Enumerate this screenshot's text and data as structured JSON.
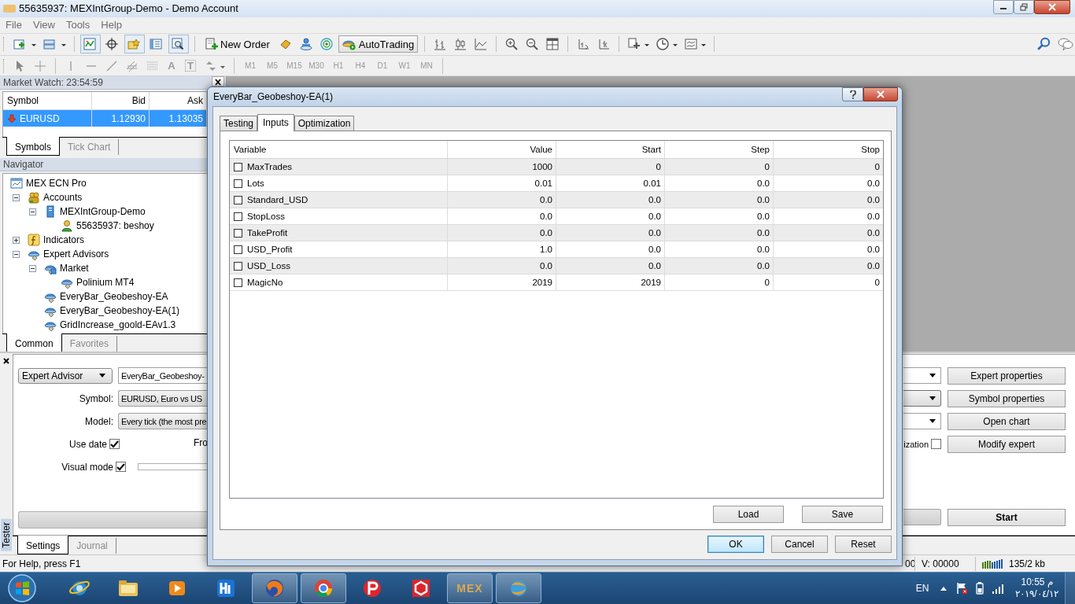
{
  "window": {
    "title": "55635937: MEXIntGroup-Demo - Demo Account"
  },
  "menu": [
    "File",
    "View",
    "Tools",
    "Help"
  ],
  "toolbar": {
    "new_order": "New Order",
    "autotrading": {
      "label": "AutoTrading",
      "on": true
    }
  },
  "toolbar2": {
    "text_tool": "A",
    "label_tool": "T",
    "timeframes": [
      {
        "label": "M1",
        "disabled": true
      },
      {
        "label": "M5",
        "disabled": true
      },
      {
        "label": "M15",
        "disabled": true
      },
      {
        "label": "M30",
        "disabled": true
      },
      {
        "label": "H1",
        "disabled": true
      },
      {
        "label": "H4",
        "disabled": true
      },
      {
        "label": "D1",
        "disabled": true
      },
      {
        "label": "W1",
        "disabled": true
      },
      {
        "label": "MN",
        "disabled": true
      }
    ]
  },
  "market_watch": {
    "title": "Market Watch: 23:54:59",
    "columns": [
      "Symbol",
      "Bid",
      "Ask"
    ],
    "rows": [
      {
        "symbol": "EURUSD",
        "bid": "1.12930",
        "ask": "1.13035",
        "selected": true
      }
    ],
    "tabs": [
      {
        "label": "Symbols",
        "selected": true
      },
      {
        "label": "Tick Chart",
        "selected": false
      }
    ]
  },
  "navigator": {
    "title": "Navigator",
    "tree": [
      {
        "label": "MEX ECN Pro",
        "kind": "terminal",
        "children": [
          {
            "label": "Accounts",
            "kind": "accounts",
            "expanded": true,
            "children": [
              {
                "label": "MEXIntGroup-Demo",
                "kind": "server",
                "expanded": true,
                "children": [
                  {
                    "label": "55635937: beshoy",
                    "kind": "user"
                  }
                ]
              }
            ]
          },
          {
            "label": "Indicators",
            "kind": "indicator",
            "expanded": false
          },
          {
            "label": "Expert Advisors",
            "kind": "expert",
            "expanded": true,
            "children": [
              {
                "label": "Market",
                "kind": "market",
                "expanded": true,
                "children": [
                  {
                    "label": "Polinium MT4",
                    "kind": "expert"
                  }
                ]
              },
              {
                "label": "EveryBar_Geobeshoy-EA",
                "kind": "expert"
              },
              {
                "label": "EveryBar_Geobeshoy-EA(1)",
                "kind": "expert"
              },
              {
                "label": "GridIncrease_goold-EAv1.3",
                "kind": "expert"
              }
            ]
          }
        ]
      }
    ],
    "tabs": [
      {
        "label": "Common",
        "selected": true
      },
      {
        "label": "Favorites",
        "selected": false
      }
    ]
  },
  "tester": {
    "tab_label": "Tester",
    "type_select": "Expert Advisor",
    "expert_field": "EveryBar_Geobeshoy-",
    "symbol_label": "Symbol:",
    "symbol_value": "EURUSD, Euro vs US",
    "model_label": "Model:",
    "model_value": "Every tick (the most pre",
    "use_date": {
      "label": "Use date",
      "checked": true
    },
    "from_label": "Fro",
    "visual_mode": {
      "label": "Visual mode",
      "checked": true
    },
    "speed": {
      "level": 0
    },
    "progress": {
      "level": 0
    },
    "optimization": {
      "label": "ization",
      "checked": false
    },
    "buttons": [
      "Expert properties",
      "Symbol properties",
      "Open chart",
      "Modify expert"
    ],
    "start": "Start",
    "tabs": [
      {
        "label": "Settings",
        "selected": true
      },
      {
        "label": "Journal",
        "selected": false
      }
    ]
  },
  "status_bar": {
    "help": "For Help, press F1",
    "cell_1": "00",
    "cell_2": "V: 00000",
    "traffic": "135/2 kb"
  },
  "dialog": {
    "title": "EveryBar_Geobeshoy-EA(1)",
    "tabs": [
      {
        "label": "Testing",
        "selected": false
      },
      {
        "label": "Inputs",
        "selected": true
      },
      {
        "label": "Optimization",
        "selected": false
      }
    ],
    "columns": [
      "Variable",
      "Value",
      "Start",
      "Step",
      "Stop"
    ],
    "rows": [
      {
        "variable": "MaxTrades",
        "value": "1000",
        "start": "0",
        "step": "0",
        "stop": "0",
        "checked": false
      },
      {
        "variable": "Lots",
        "value": "0.01",
        "start": "0.01",
        "step": "0.0",
        "stop": "0.0",
        "checked": false
      },
      {
        "variable": "Standard_USD",
        "value": "0.0",
        "start": "0.0",
        "step": "0.0",
        "stop": "0.0",
        "checked": false
      },
      {
        "variable": "StopLoss",
        "value": "0.0",
        "start": "0.0",
        "step": "0.0",
        "stop": "0.0",
        "checked": false
      },
      {
        "variable": "TakeProfit",
        "value": "0.0",
        "start": "0.0",
        "step": "0.0",
        "stop": "0.0",
        "checked": false
      },
      {
        "variable": "USD_Profit",
        "value": "1.0",
        "start": "0.0",
        "step": "0.0",
        "stop": "0.0",
        "checked": false
      },
      {
        "variable": "USD_Loss",
        "value": "0.0",
        "start": "0.0",
        "step": "0.0",
        "stop": "0.0",
        "checked": false
      },
      {
        "variable": "MagicNo",
        "value": "2019",
        "start": "2019",
        "step": "0",
        "stop": "0",
        "checked": false
      }
    ],
    "panel_buttons": [
      "Load",
      "Save"
    ],
    "buttons": [
      "OK",
      "Cancel",
      "Reset"
    ]
  },
  "taskbar": {
    "items": [
      {
        "kind": "ie",
        "running": false
      },
      {
        "kind": "folder",
        "running": false
      },
      {
        "kind": "media",
        "running": false
      },
      {
        "kind": "hw",
        "running": false
      },
      {
        "kind": "firefox",
        "running": true
      },
      {
        "kind": "chrome",
        "running": true
      },
      {
        "kind": "papp",
        "running": false
      },
      {
        "kind": "cube",
        "running": false
      },
      {
        "kind": "mex",
        "label": "MEX",
        "running": true
      },
      {
        "kind": "globe",
        "running": true
      }
    ],
    "language": "EN",
    "time": "10:55 م",
    "date": "٢٠١٩/٠٤/١٢"
  }
}
